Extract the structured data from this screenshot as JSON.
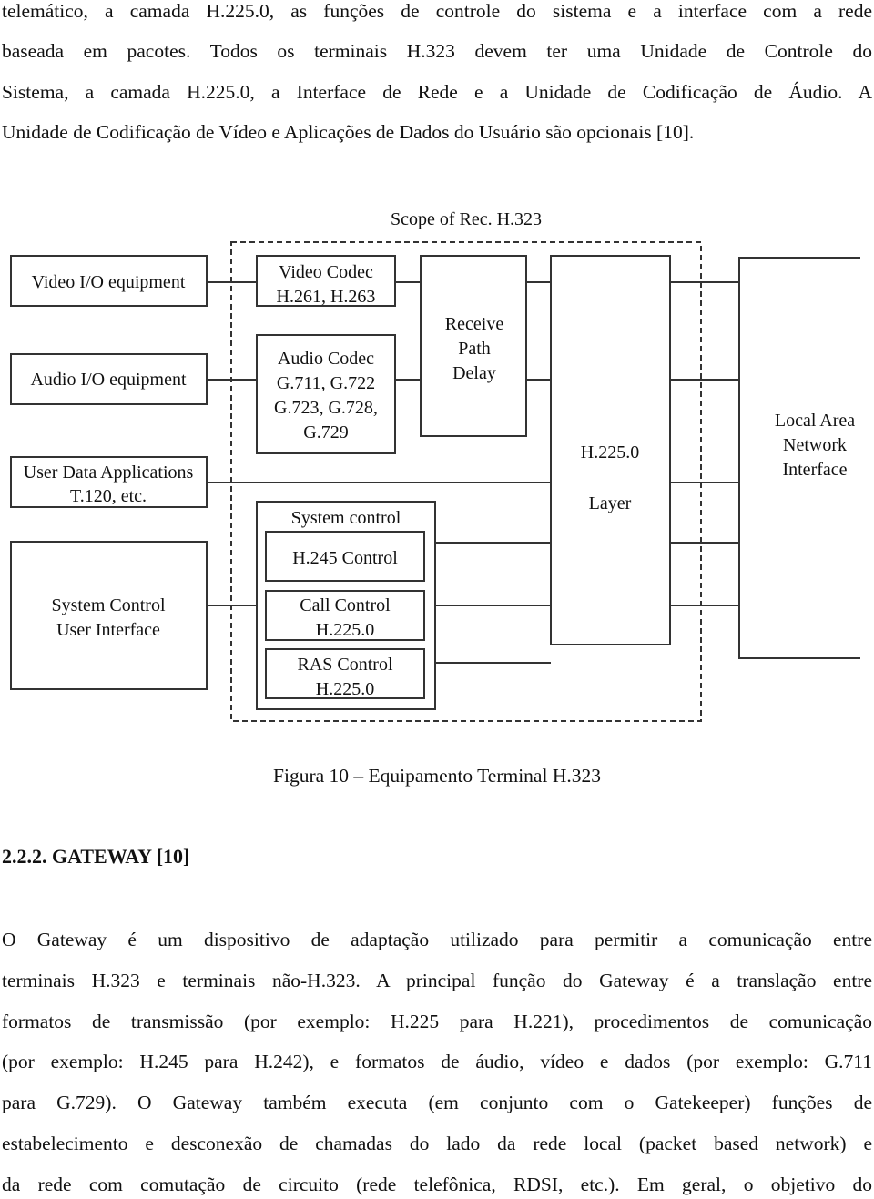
{
  "paragraph_top": [
    "telemático, a camada H.225.0, as funções de controle do sistema e a interface com a rede",
    "baseada em pacotes. Todos os terminais H.323 devem ter uma Unidade de Controle do",
    "Sistema, a camada H.225.0, a Interface de Rede e a Unidade de Codificação de Áudio. A",
    "Unidade de Codificação de Vídeo e Aplicações de Dados do Usuário são opcionais [10]."
  ],
  "diagram": {
    "scope_label": "Scope of Rec. H.323",
    "video_io": "Video I/O equipment",
    "audio_io": "Audio I/O equipment",
    "user_data": [
      "User Data Applications",
      "T.120, etc."
    ],
    "sys_ui": [
      "System Control",
      "User Interface"
    ],
    "video_codec": [
      "Video Codec",
      "H.261, H.263"
    ],
    "audio_codec": [
      "Audio Codec",
      "G.711, G.722",
      "G.723, G.728,",
      "G.729"
    ],
    "receive_path": [
      "Receive",
      "Path",
      "Delay"
    ],
    "system_control": "System control",
    "h245": "H.245 Control",
    "call_control": [
      "Call Control",
      "H.225.0"
    ],
    "ras_control": [
      "RAS Control",
      "H.225.0"
    ],
    "h225_layer": [
      "H.225.0",
      "Layer"
    ],
    "lan": [
      "Local Area",
      "Network",
      "Interface"
    ]
  },
  "caption": "Figura 10 – Equipamento Terminal H.323",
  "section_heading": "2.2.2. GATEWAY [10]",
  "paragraph_bottom": [
    "O Gateway é um dispositivo de adaptação utilizado para permitir a comunicação entre",
    "terminais H.323 e terminais não-H.323. A principal função do Gateway é a translação entre",
    "formatos de transmissão (por exemplo: H.225 para H.221), procedimentos de comunicação",
    "(por exemplo: H.245 para H.242), e formatos de áudio, vídeo e dados (por exemplo: G.711",
    "para G.729). O Gateway também executa (em conjunto com o Gatekeeper) funções de",
    "estabelecimento e desconexão de chamadas do lado da rede local (packet based network) e",
    "da rede com comutação de circuito (rede telefônica, RDSI, etc.). Em geral, o objetivo do"
  ]
}
